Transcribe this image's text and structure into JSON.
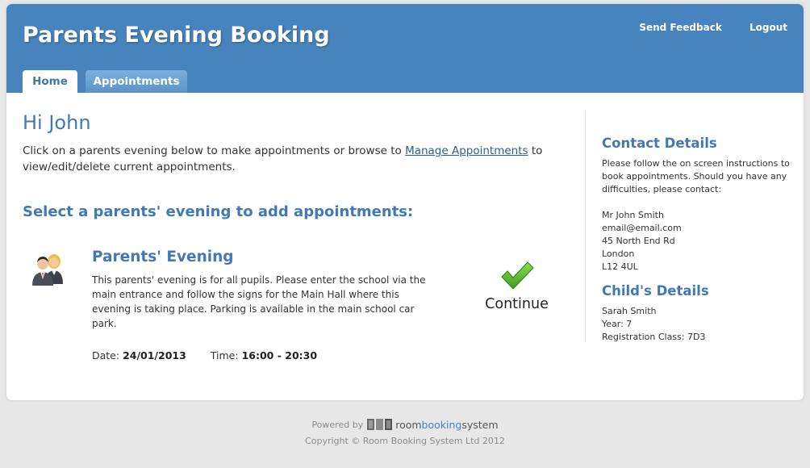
{
  "header": {
    "title": "Parents Evening Booking",
    "links": {
      "feedback": "Send Feedback",
      "logout": "Logout"
    },
    "tabs": [
      {
        "label": "Home",
        "active": true
      },
      {
        "label": "Appointments",
        "active": false
      }
    ]
  },
  "main": {
    "greeting": "Hi John",
    "intro_before": "Click on a parents evening below to make appointments or browse to ",
    "intro_link": "Manage Appointments",
    "intro_after": " to view/edit/delete current appointments.",
    "section_title": "Select a parents' evening to add appointments:",
    "event": {
      "icon": "parents-icon",
      "title": "Parents' Evening",
      "description": "This parents' evening is for all pupils. Please enter the school via the main entrance and follow the signs for the Main Hall where this evening is taking place. Parking is available in the main school car park.",
      "date_label": "Date:",
      "date_value": "24/01/2013",
      "time_label": "Time:",
      "time_value": "16:00 - 20:30",
      "continue_label": "Continue",
      "continue_icon": "checkmark-icon"
    }
  },
  "sidebar": {
    "contact": {
      "title": "Contact Details",
      "instructions": "Please follow the on screen instructions to book appointments. Should you have any difficulties, please contact:",
      "name": "Mr John Smith",
      "email": "email@email.com",
      "address1": "45 North End Rd",
      "city": "London",
      "postcode": "L12 4UL"
    },
    "child": {
      "title": "Child's Details",
      "name": "Sarah Smith",
      "year": "Year: 7",
      "reg_class": "Registration Class: 7D3"
    }
  },
  "footer": {
    "powered_by": "Powered by",
    "logo_part1": "room",
    "logo_part2": "booking",
    "logo_part3": "system",
    "copyright": "Copyright © Room Booking System Ltd 2012"
  },
  "colors": {
    "header_bg": "#4784bd",
    "heading": "#4279b4",
    "page_bg": "#e7e7e7",
    "check_green": "#4cae2b"
  }
}
